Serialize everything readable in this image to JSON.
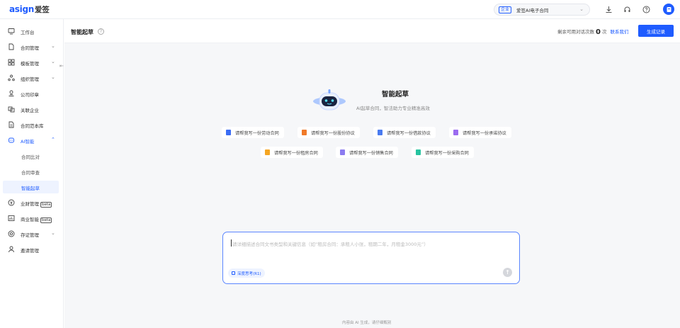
{
  "app": {
    "logo_text": "asign",
    "logo_cn": "爱签",
    "org_tag": "企业",
    "org_name": "爱签AI电子合同",
    "brand_color": "#1f5cff"
  },
  "sidebar": {
    "items": [
      {
        "label": "工作台",
        "icon": "monitor-icon"
      },
      {
        "label": "合同管理",
        "icon": "document-icon",
        "expandable": true
      },
      {
        "label": "模板管理",
        "icon": "template-icon",
        "expandable": true
      },
      {
        "label": "组织管理",
        "icon": "org-icon",
        "expandable": true
      },
      {
        "label": "公司印章",
        "icon": "seal-icon"
      },
      {
        "label": "关联企业",
        "icon": "linked-company-icon"
      },
      {
        "label": "合同范本库",
        "icon": "library-icon"
      },
      {
        "label": "AI智能",
        "icon": "ai-icon",
        "expanded": true
      },
      {
        "label": "合同比对"
      },
      {
        "label": "合同审查"
      },
      {
        "label": "智能起草",
        "active": true
      },
      {
        "label": "业财管理",
        "icon": "finance-icon",
        "badge": "beta"
      },
      {
        "label": "商业智能",
        "icon": "bi-icon",
        "badge": "beta"
      },
      {
        "label": "存证管理",
        "icon": "evidence-icon",
        "expandable": true
      },
      {
        "label": "邀请管理",
        "icon": "invite-icon"
      }
    ]
  },
  "header": {
    "title": "智能起草",
    "quota_prefix": "剩余可用对话次数",
    "quota_count": "0",
    "quota_unit": "次",
    "contact_link": "联系我们",
    "generate_button": "生成记录"
  },
  "hero": {
    "title": "智能起草",
    "subtitle": "AI起草合同，智法助力专业精准高效"
  },
  "suggestions": [
    {
      "label": "请帮我写一份劳动合同",
      "color": "#3a6cf4"
    },
    {
      "label": "请帮我写一份股份协议",
      "color": "#f07a2a"
    },
    {
      "label": "请帮我写一份借款协议",
      "color": "#4a7bf0"
    },
    {
      "label": "请帮我写一份承诺协议",
      "color": "#9b6cf0"
    },
    {
      "label": "请帮我写一份租房合同",
      "color": "#f5a623"
    },
    {
      "label": "请帮我写一份销售合同",
      "color": "#8c7cf0"
    },
    {
      "label": "请帮我写一份采购合同",
      "color": "#27c3a0"
    }
  ],
  "prompt": {
    "placeholder": "请详细描述合同文书类型和关键信息（如“租房合同：承租人小张，租期二年，月租金3000元”）",
    "deep_think_label": "深度思考(R1)"
  },
  "footer_note": "内容由 AI 生成，请仔细甄别"
}
